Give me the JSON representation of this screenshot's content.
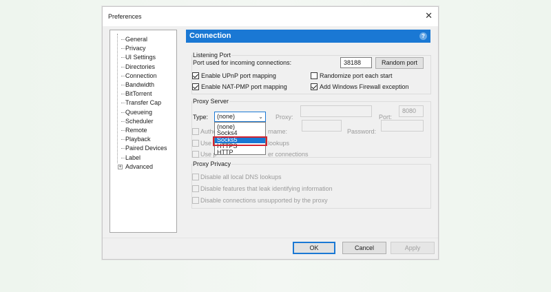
{
  "window": {
    "title": "Preferences",
    "close_glyph": "✕"
  },
  "tree": {
    "items": [
      "General",
      "Privacy",
      "UI Settings",
      "Directories",
      "Connection",
      "Bandwidth",
      "BitTorrent",
      "Transfer Cap",
      "Queueing",
      "Scheduler",
      "Remote",
      "Playback",
      "Paired Devices",
      "Label",
      "Advanced"
    ],
    "advanced_expander": "+"
  },
  "header": {
    "title": "Connection",
    "help_glyph": "?"
  },
  "listening_port": {
    "group_label": "Listening Port",
    "port_label": "Port used for incoming connections:",
    "port_value": "38188",
    "random_port_button": "Random port",
    "upnp": {
      "label": "Enable UPnP port mapping",
      "checked": true
    },
    "randomize": {
      "label": "Randomize port each start",
      "checked": false
    },
    "natpmp": {
      "label": "Enable NAT-PMP port mapping",
      "checked": true
    },
    "firewall": {
      "label": "Add Windows Firewall exception",
      "checked": true
    }
  },
  "proxy_server": {
    "group_label": "Proxy Server",
    "type_label": "Type:",
    "type_value": "(none)",
    "proxy_label": "Proxy:",
    "port_label": "Port:",
    "port_value": "8080",
    "auth_label_partial": "Authe",
    "username_label_partial": "rname:",
    "password_label": "Password:",
    "use_1_partial": "Use p",
    "use_1_tail": "lookups",
    "use_2_partial": "Use p",
    "use_2_tail": "er connections",
    "dropdown_options": [
      "(none)",
      "Socks4",
      "Socks5",
      "HTTPS",
      "HTTP"
    ],
    "selected_option": "Socks5"
  },
  "proxy_privacy": {
    "group_label": "Proxy Privacy",
    "dns": "Disable all local DNS lookups",
    "leak": "Disable features that leak identifying information",
    "unsupported": "Disable connections unsupported by the proxy"
  },
  "buttons": {
    "ok": "OK",
    "cancel": "Cancel",
    "apply": "Apply"
  },
  "colors": {
    "accent": "#1a78d4",
    "highlight_box": "#d3232f"
  }
}
